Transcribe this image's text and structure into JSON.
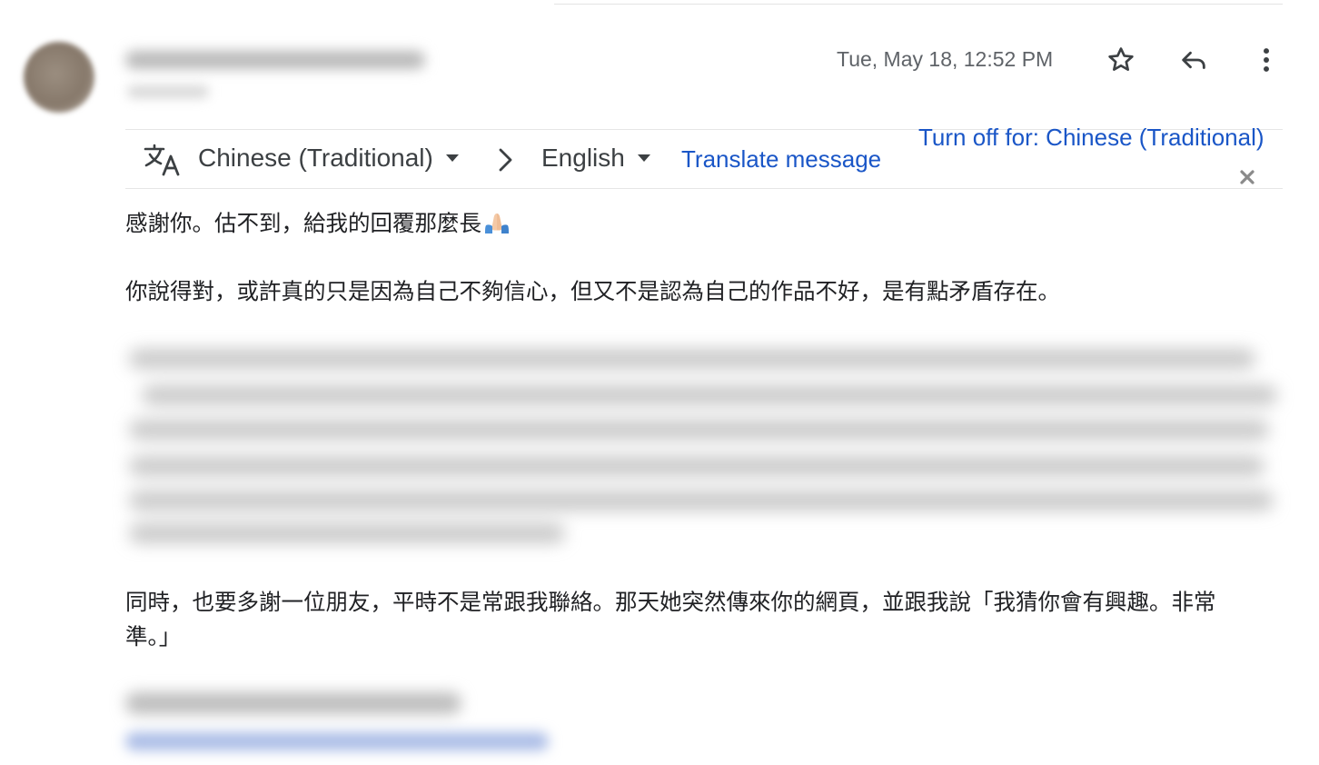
{
  "header": {
    "timestamp": "Tue, May 18, 12:52 PM",
    "icons": {
      "star": "star-icon",
      "reply": "reply-icon",
      "more": "more-vert-icon"
    }
  },
  "translate_bar": {
    "icon": "translate-icon",
    "source_language": "Chinese (Traditional)",
    "target_language": "English",
    "translate_link": "Translate message",
    "turn_off_link": "Turn off for: Chinese (Traditional)",
    "close_icon": "close-icon"
  },
  "message": {
    "paragraph_1": "感謝你。估不到，給我的回覆那麼長",
    "paragraph_1_emoji": "folded-hands-emoji",
    "paragraph_2": "你說得對，或許真的只是因為自己不夠信心，但又不是認為自己的作品不好，是有點矛盾存在。",
    "paragraph_3_line1": "同時，也要多謝一位朋友，平時不是常跟我聯絡。那天她突然傳來你的網頁，並跟我說「我猜你會有興趣。非常",
    "paragraph_3_line2": "準。」"
  },
  "colors": {
    "link": "#1a56c7",
    "text": "#202124",
    "secondary": "#5f6368"
  }
}
